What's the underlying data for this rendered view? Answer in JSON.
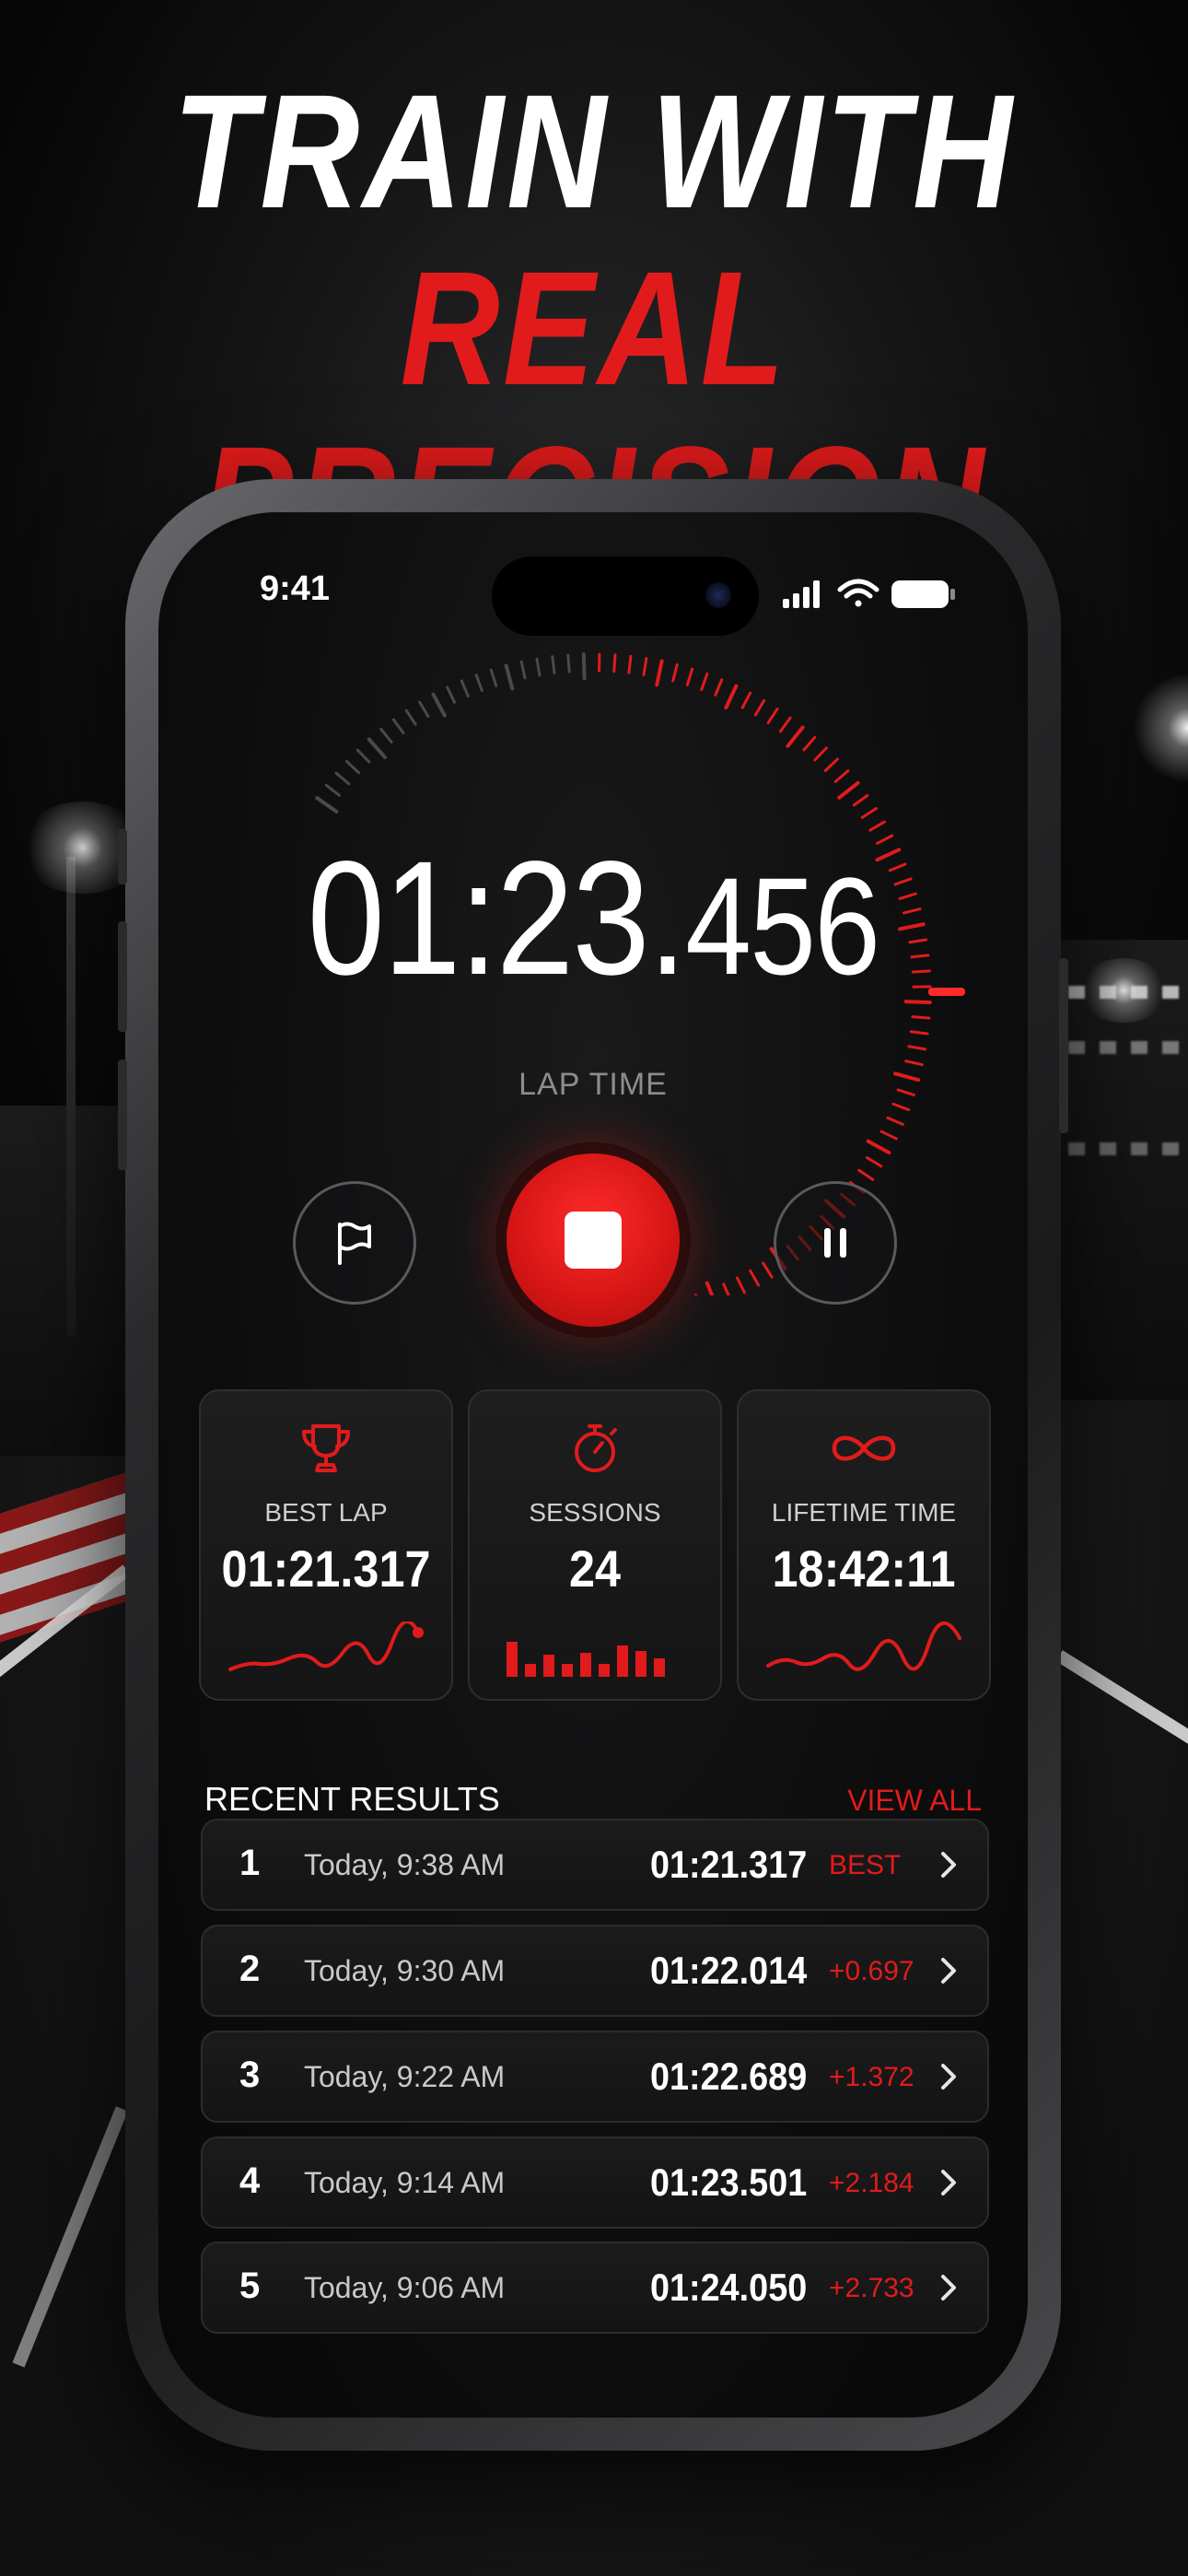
{
  "headline": {
    "line1": "TRAIN WITH",
    "line2": "REAL PRECISION"
  },
  "status_bar": {
    "time": "9:41",
    "icons": [
      "signal-icon",
      "wifi-icon",
      "battery-icon"
    ]
  },
  "timer": {
    "main": "01:23.",
    "ms": "456",
    "label": "LAP TIME"
  },
  "controls": {
    "flag_icon": "flag-icon",
    "stop_icon": "stop-icon",
    "pause_icon": "pause-icon"
  },
  "stats": [
    {
      "icon": "trophy-icon",
      "label": "BEST LAP",
      "value": "01:21.317"
    },
    {
      "icon": "stopwatch-icon",
      "label": "SESSIONS",
      "value": "24"
    },
    {
      "icon": "infinity-icon",
      "label": "LIFETIME TIME",
      "value": "18:42:11"
    }
  ],
  "recent": {
    "title": "RECENT RESULTS",
    "view_all": "VIEW ALL",
    "rows": [
      {
        "rank": "1",
        "when": "Today, 9:38 AM",
        "time": "01:21.317",
        "delta": "BEST"
      },
      {
        "rank": "2",
        "when": "Today, 9:30 AM",
        "time": "01:22.014",
        "delta": "+0.697"
      },
      {
        "rank": "3",
        "when": "Today, 9:22 AM",
        "time": "01:22.689",
        "delta": "+1.372"
      },
      {
        "rank": "4",
        "when": "Today, 9:14 AM",
        "time": "01:23.501",
        "delta": "+2.184"
      },
      {
        "rank": "5",
        "when": "Today, 9:06 AM",
        "time": "01:24.050",
        "delta": "+2.733"
      }
    ]
  },
  "colors": {
    "accent": "#e11b1b",
    "background": "#0d0d0e",
    "card": "#1a1a1b",
    "text": "#ffffff",
    "muted": "#8d8d90"
  }
}
